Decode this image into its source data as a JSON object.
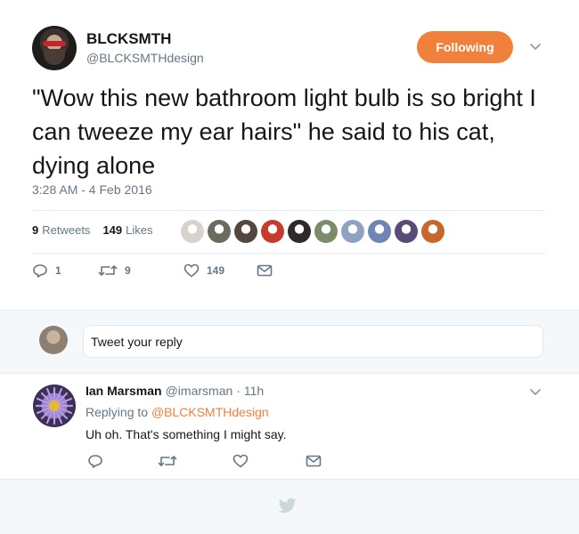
{
  "tweet": {
    "author_name": "BLCKSMTH",
    "author_handle": "@BLCKSMTHdesign",
    "follow_label": "Following",
    "text": "\"Wow this new bathroom light bulb is so bright I can tweeze my ear hairs\" he said to his cat, dying alone",
    "timestamp": "3:28 AM - 4 Feb 2016",
    "stats": {
      "retweets_count": "9",
      "retweets_label": "Retweets",
      "likes_count": "149",
      "likes_label": "Likes"
    },
    "likers": [
      "#d8d2cc",
      "#6b6b5e",
      "#54473f",
      "#c63b2c",
      "#2e2a2a",
      "#7b8c6a",
      "#8ea3c4",
      "#6f86b5",
      "#5a4a7a",
      "#c7672a"
    ],
    "actions": {
      "reply_count": "1",
      "retweet_count": "9",
      "like_count": "149"
    }
  },
  "compose": {
    "placeholder": "Tweet your reply"
  },
  "reply": {
    "author_name": "Ian Marsman",
    "author_handle": "@imarsman",
    "time": "· 11h",
    "replying_prefix": "Replying to",
    "replying_handle": "@BLCKSMTHdesign",
    "text": "Uh oh. That's something I might say."
  },
  "colors": {
    "accent": "#f0803c",
    "muted": "#657786",
    "icon": "#657786",
    "footer_bird": "#ccd6dd"
  },
  "icons": {
    "reply": "reply-icon",
    "retweet": "retweet-icon",
    "like": "heart-icon",
    "dm": "envelope-icon",
    "caret": "chevron-down-icon",
    "logo": "twitter-bird-icon"
  }
}
